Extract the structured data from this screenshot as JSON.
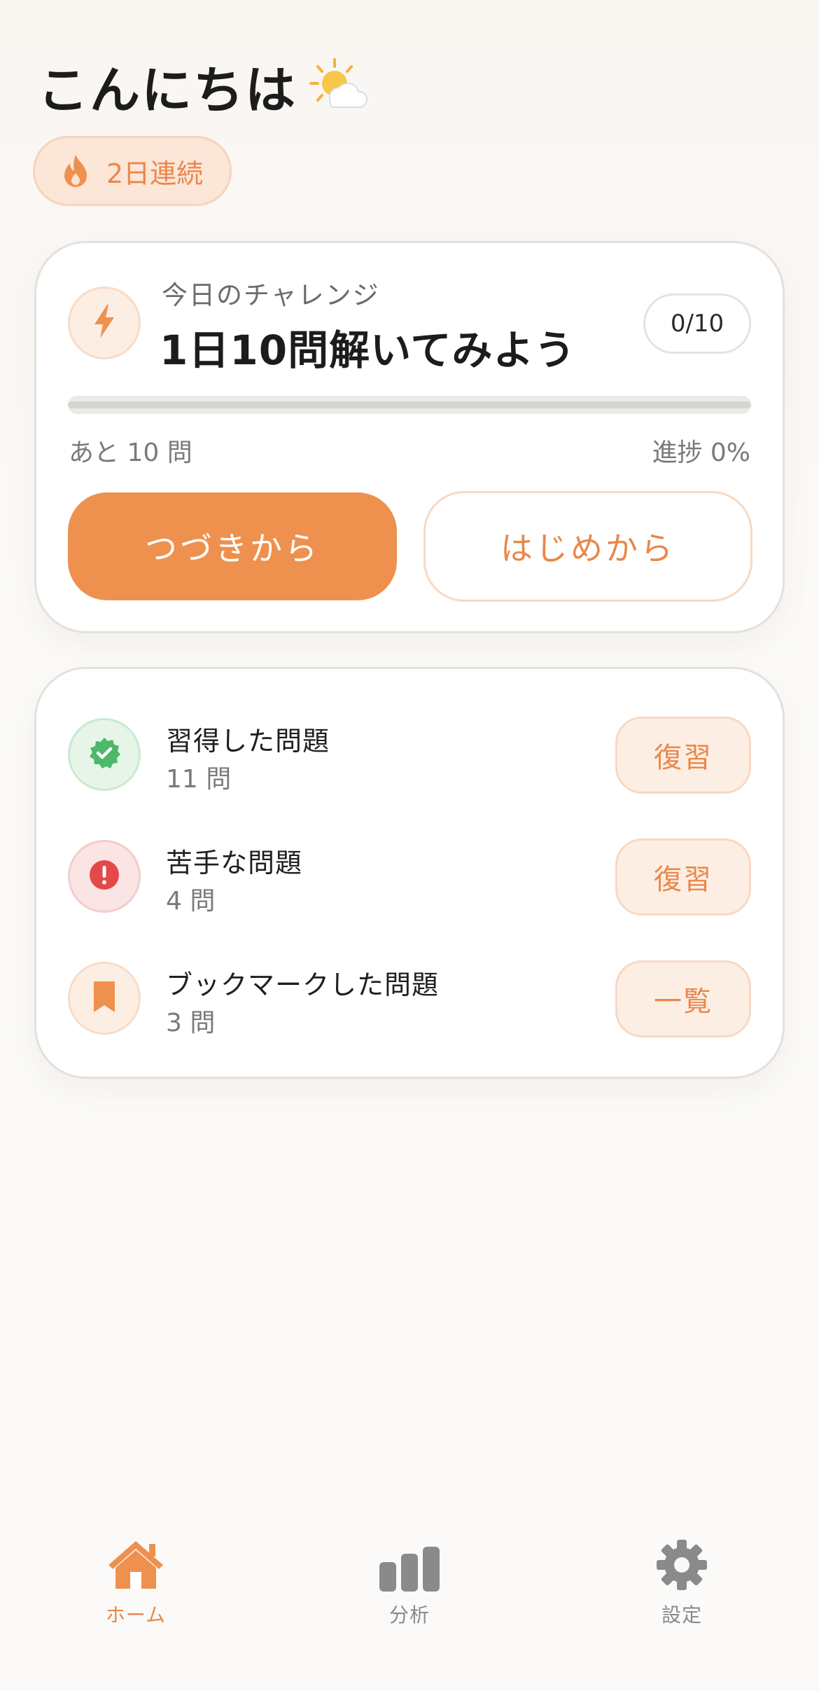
{
  "header": {
    "greeting": "こんにちは",
    "weather_icon": "sun-behind-cloud-icon"
  },
  "streak": {
    "label": "2日連続",
    "icon": "flame-icon"
  },
  "challenge": {
    "subtitle": "今日のチャレンジ",
    "title": "1日10問解いてみよう",
    "count": "0/10",
    "progress_fraction": 0,
    "remaining_label": "あと 10 問",
    "progress_label": "進捗 0%",
    "continue_label": "つづきから",
    "restart_label": "はじめから",
    "icon": "lightning-icon"
  },
  "lists": {
    "items": [
      {
        "title": "習得した問題",
        "count": "11 問",
        "action": "復習",
        "icon": "verified-check-icon",
        "icon_color": "#4cb96a",
        "icon_bg": "#e6f5e8",
        "icon_border": "#cbe9d1"
      },
      {
        "title": "苦手な問題",
        "count": "4 問",
        "action": "復習",
        "icon": "exclamation-icon",
        "icon_color": "#e54848",
        "icon_bg": "#fbe4e4",
        "icon_border": "#f4cccc"
      },
      {
        "title": "ブックマークした問題",
        "count": "3 問",
        "action": "一覧",
        "icon": "bookmark-icon",
        "icon_color": "#ee914e",
        "icon_bg": "#fdeee3",
        "icon_border": "#f8dcc8"
      }
    ]
  },
  "nav": {
    "items": [
      {
        "label": "ホーム",
        "icon": "home-icon",
        "active": true
      },
      {
        "label": "分析",
        "icon": "bar-chart-icon",
        "active": false
      },
      {
        "label": "設定",
        "icon": "gear-icon",
        "active": false
      }
    ]
  },
  "colors": {
    "accent": "#ee914e",
    "accent_text": "#e8884b",
    "inactive": "#8a8a8a"
  }
}
